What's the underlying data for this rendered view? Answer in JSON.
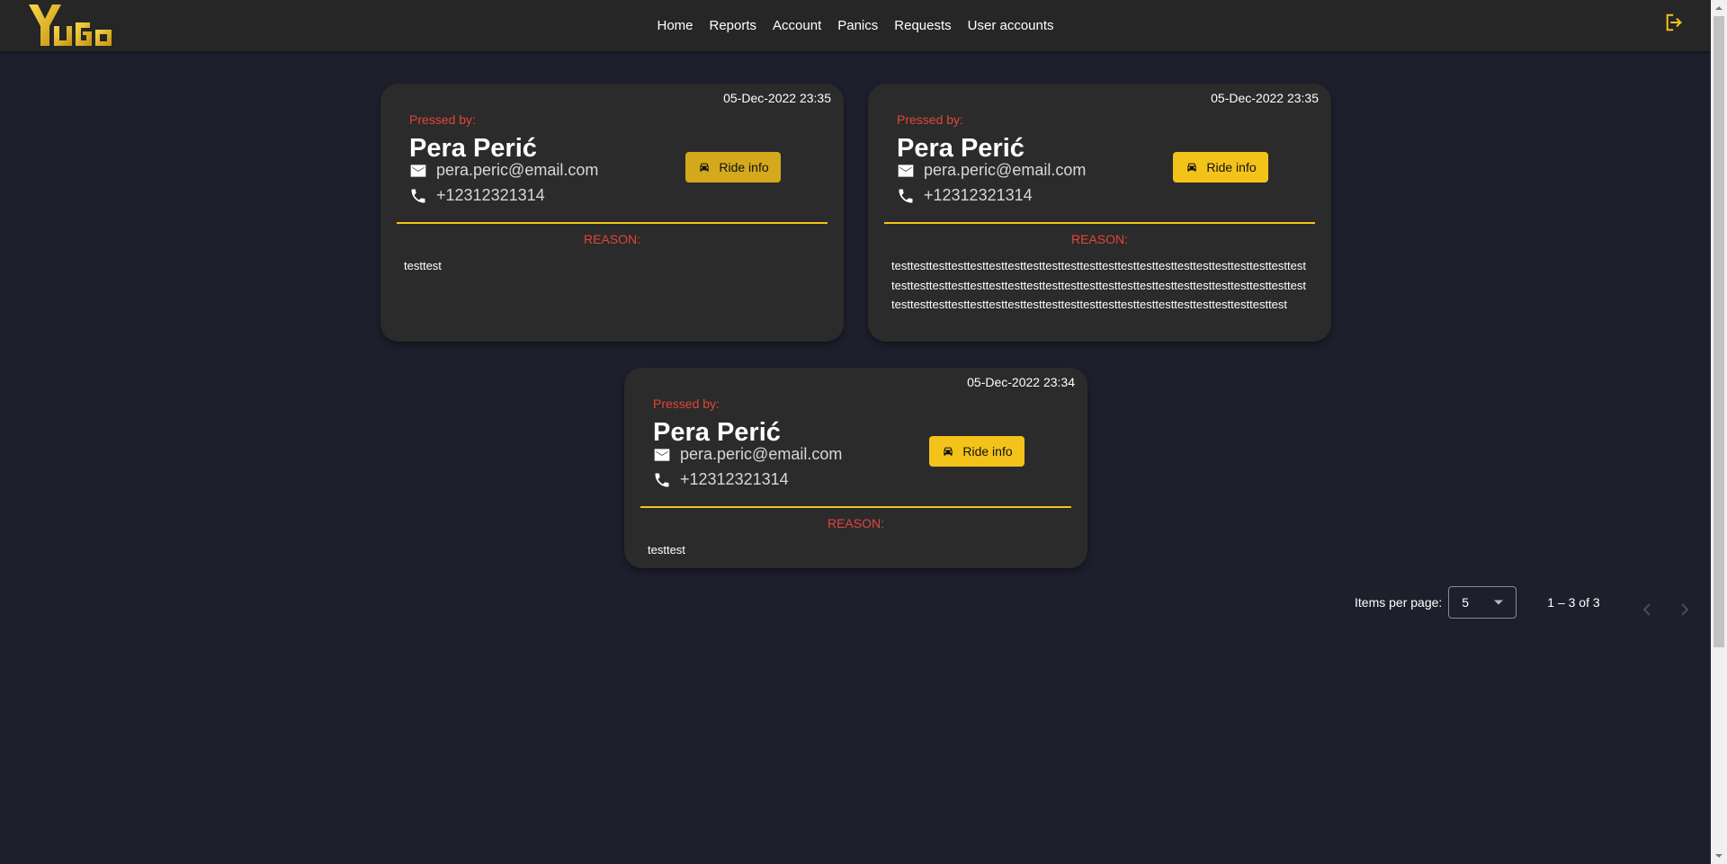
{
  "brand": {
    "logo_text": "YuGo",
    "accent_color": "#f3c31a"
  },
  "nav": {
    "items": [
      {
        "label": "Home"
      },
      {
        "label": "Reports"
      },
      {
        "label": "Account"
      },
      {
        "label": "Panics"
      },
      {
        "label": "Requests"
      },
      {
        "label": "User accounts"
      }
    ],
    "logout_icon": "logout-icon"
  },
  "panics": [
    {
      "date": "05-Dec-2022 23:35",
      "pressed_by_label": "Pressed by:",
      "name": "Pera Perić",
      "email": "pera.peric@email.com",
      "phone": "+12312321314",
      "ride_info_label": "Ride info",
      "reason_label": "REASON:",
      "reason": "testtest"
    },
    {
      "date": "05-Dec-2022 23:35",
      "pressed_by_label": "Pressed by:",
      "name": "Pera Perić",
      "email": "pera.peric@email.com",
      "phone": "+12312321314",
      "ride_info_label": "Ride info",
      "reason_label": "REASON:",
      "reason": "testtesttesttesttesttesttesttesttesttesttesttesttesttesttesttesttesttesttesttesttesttesttesttesttesttesttesttesttesttesttesttesttesttesttesttesttesttesttesttesttesttesttesttesttesttesttesttesttesttesttesttesttesttesttesttesttesttesttesttesttesttesttesttesttest"
    },
    {
      "date": "05-Dec-2022 23:34",
      "pressed_by_label": "Pressed by:",
      "name": "Pera Perić",
      "email": "pera.peric@email.com",
      "phone": "+12312321314",
      "ride_info_label": "Ride info",
      "reason_label": "REASON:",
      "reason": "testtest"
    }
  ],
  "paginator": {
    "items_per_page_label": "Items per page:",
    "items_per_page_value": "5",
    "range_label": "1 – 3 of 3"
  },
  "colors": {
    "background": "#1e1f2d",
    "card": "#2b2b2b",
    "topbar": "#262626",
    "reason_red": "#e2453a",
    "button_yellow": "#f3c31a"
  }
}
